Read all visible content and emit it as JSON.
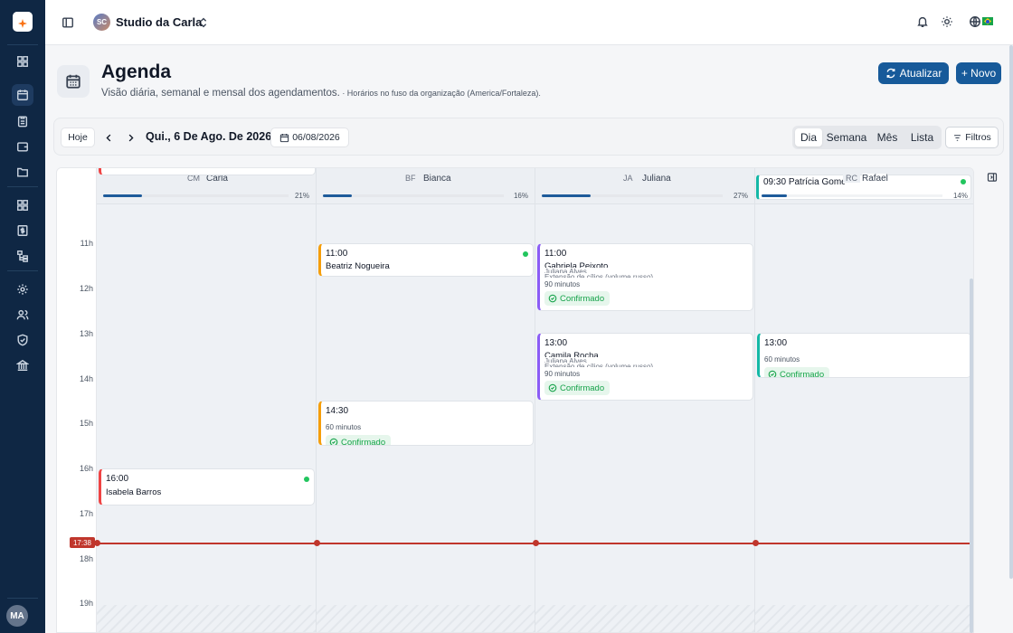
{
  "app": {
    "org_initials": "SC",
    "org_name": "Studio da Carla",
    "user_initials": "MA"
  },
  "header": {
    "title": "Agenda",
    "subtitle": "Visão diária, semanal e mensal dos agendamentos.",
    "timezone_note": " · Horários no fuso da organização (America/Fortaleza).",
    "refresh_label": "Atualizar",
    "new_label": "+ Novo"
  },
  "toolbar": {
    "today_label": "Hoje",
    "current_date": "Qui., 6 De Ago. De 2026",
    "date_input": "06/08/2026",
    "views": [
      {
        "label": "Dia",
        "active": true
      },
      {
        "label": "Semana",
        "active": false
      },
      {
        "label": "Mês",
        "active": false
      },
      {
        "label": "Lista",
        "active": false
      }
    ],
    "filters_label": "Filtros"
  },
  "hours": [
    "11h",
    "12h",
    "13h",
    "14h",
    "15h",
    "16h",
    "17h",
    "18h",
    "19h"
  ],
  "now_label": "17:38",
  "professionals": [
    {
      "initials": "CM",
      "name": "Carla",
      "occupancy": 21,
      "occupancy_label": "21%"
    },
    {
      "initials": "BF",
      "name": "Bianca",
      "occupancy": 16,
      "occupancy_label": "16%"
    },
    {
      "initials": "JA",
      "name": "Juliana",
      "occupancy": 27,
      "occupancy_label": "27%"
    },
    {
      "initials": "RC",
      "name": "Rafael",
      "occupancy": 14,
      "occupancy_label": "14%"
    }
  ],
  "events": {
    "e1": {
      "time": "11:00",
      "client": "Beatriz Nogueira",
      "color": "#f59e0b"
    },
    "e2": {
      "time": "11:00",
      "client": "Gabriela Peixoto",
      "professional": "Juliana Alves",
      "service": "Extensão de cílios (volume russo)",
      "duration": "90 minutos",
      "status": "Confirmado",
      "color": "#8b5cf6"
    },
    "e3": {
      "time": "13:00",
      "client": "Camila Rocha",
      "professional": "Juliana Alves",
      "service": "Extensão de cílios (volume russo)",
      "duration": "90 minutos",
      "status": "Confirmado",
      "color": "#8b5cf6"
    },
    "e4": {
      "time": "13:00",
      "duration": "60 minutos",
      "status": "Confirmado",
      "color": "#14b8a6"
    },
    "e5": {
      "time": "14:30",
      "duration": "60 minutos",
      "status": "Confirmado",
      "color": "#f59e0b"
    },
    "e6": {
      "time": "16:00",
      "client": "Isabela Barros",
      "color": "#ef4444"
    },
    "e7": {
      "time": "09:30",
      "client": "Patrícia Gomes",
      "color": "#14b8a6"
    }
  },
  "colors": {
    "sidebar": "#0f2744",
    "primary": "#175a9a",
    "now_line": "#c0362c",
    "confirmed": "#16a34a"
  }
}
